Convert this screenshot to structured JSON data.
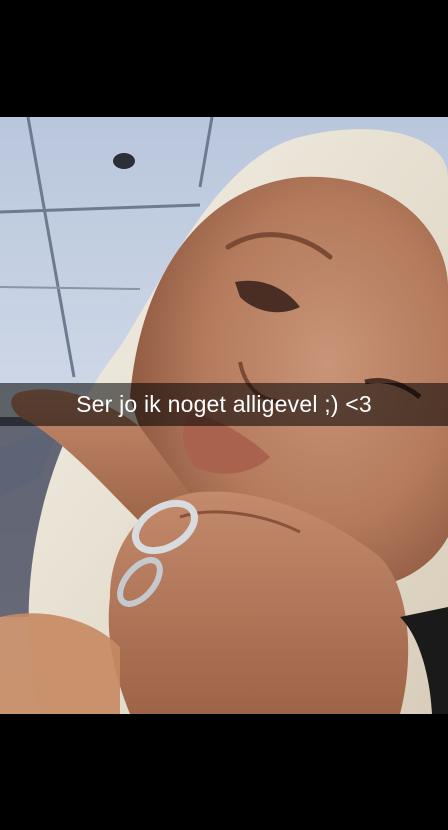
{
  "snap": {
    "caption": "Ser jo ik noget alligevel ;) <3"
  }
}
